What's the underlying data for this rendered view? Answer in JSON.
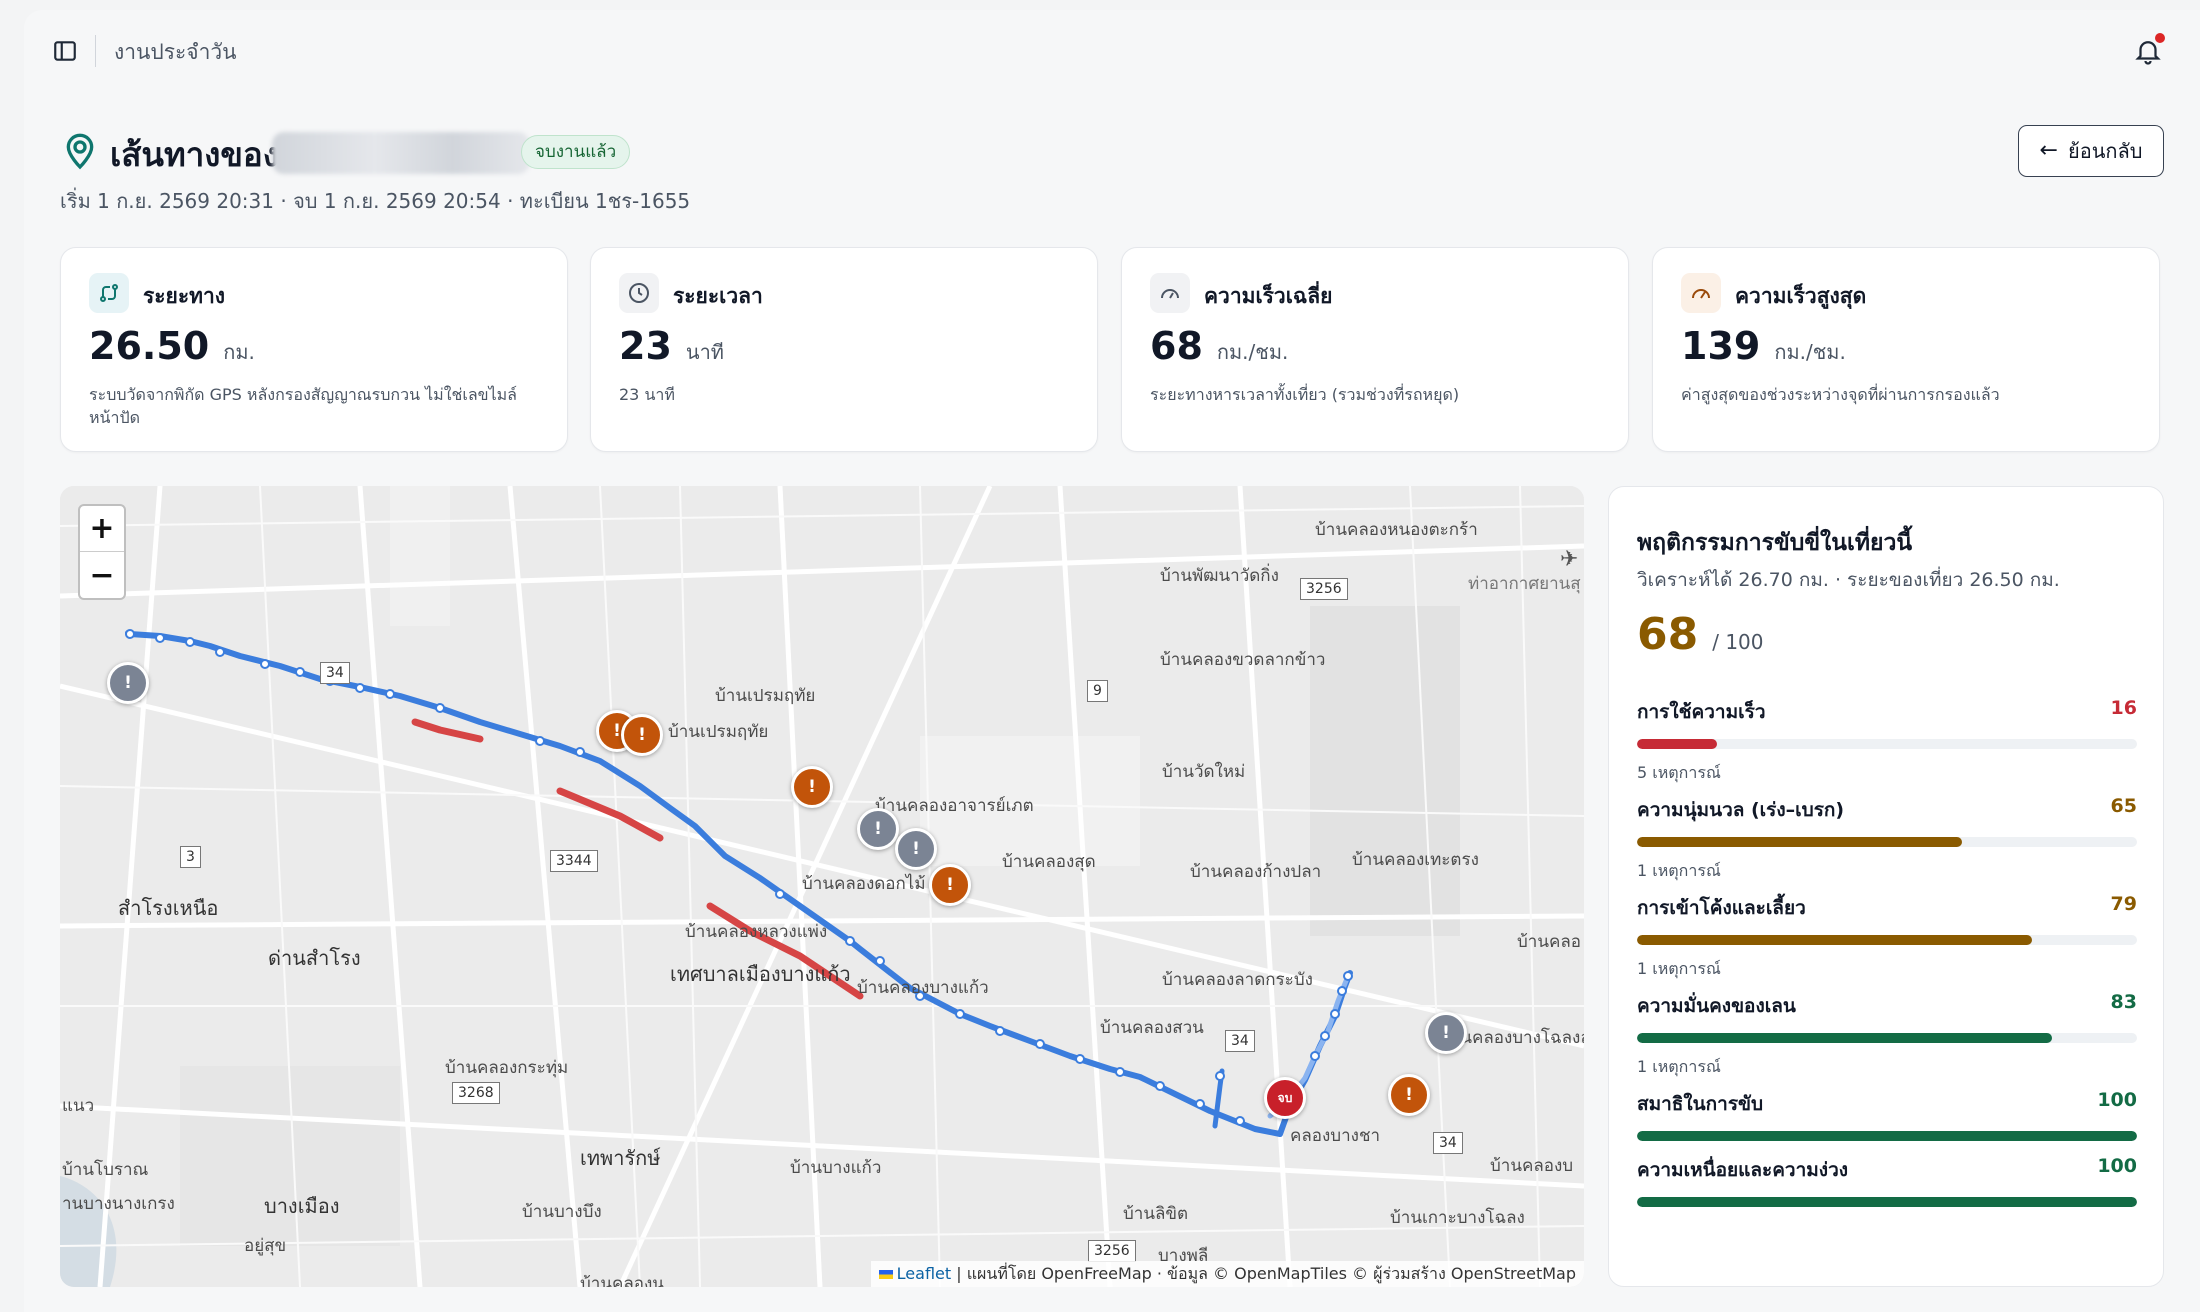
{
  "topbar": {
    "breadcrumb": "งานประจำวัน"
  },
  "header": {
    "title": "เส้นทางของ",
    "status": "จบงานแล้ว",
    "subtitle": "เริ่ม 1 ก.ย. 2569 20:31 · จบ 1 ก.ย. 2569 20:54 · ทะเบียน 1ชร-1655",
    "back_label": "ย้อนกลับ"
  },
  "stats": [
    {
      "title": "ระยะทาง",
      "value": "26.50",
      "unit": "กม.",
      "note": "ระบบวัดจากพิกัด GPS หลังกรองสัญญาณรบกวน ไม่ใช่เลขไมล์หน้าปัด"
    },
    {
      "title": "ระยะเวลา",
      "value": "23",
      "unit": "นาที",
      "note": "23 นาที"
    },
    {
      "title": "ความเร็วเฉลี่ย",
      "value": "68",
      "unit": "กม./ชม.",
      "note": "ระยะทางหารเวลาทั้งเที่ยว (รวมช่วงที่รถหยุด)"
    },
    {
      "title": "ความเร็วสูงสุด",
      "value": "139",
      "unit": "กม./ชม.",
      "note": "ค่าสูงสุดของช่วงระหว่างจุดที่ผ่านการกรองแล้ว"
    }
  ],
  "map": {
    "zoom_in": "+",
    "zoom_out": "−",
    "labels": [
      "บ้านคลองหนองตะกร้า",
      "บ้านพัฒนาวัดกิ่ง",
      "ท่าอากาศยานสุ",
      "บ้านคลองขวดลากข้าว",
      "บ้านเปรมฤทัย",
      "บ้านเปรมฤทัย",
      "บ้านวัดใหม่",
      "บ้านคลองอาจารย์เภต",
      "บ้านคลองสุด",
      "บ้านคลองก้างปลา",
      "บ้านคลองเทะตรง",
      "บ้านคลองดอกไม้",
      "บ้านคลองหลวงแพ่ง",
      "เทศบาลเมืองบางแก้ว",
      "บ้านคลองบางแก้ว",
      "บ้านคลองลาดกระบัง",
      "บ้านคลองสวน",
      "บ้านคลองบางโฉลงล่",
      "บ้านคลอ",
      "สำโรงเหนือ",
      "ด่านสำโรง",
      "บ้านคลองกระทุ่ม",
      "เทพารักษ์",
      "บ้านบางแก้ว",
      "คลองบางชา",
      "บ้านคลองบ",
      "บ้านโบราณ",
      "านบางนางเกรง",
      "บางเมือง",
      "อยู่สุข",
      "บ้านบางบึง",
      "บ้านลิขิต",
      "บ้านเกาะบางโฉลง",
      "บางพลี",
      "แนว",
      "บ้านคลองน"
    ],
    "shields": [
      "34",
      "3256",
      "9",
      "3",
      "3344",
      "3268",
      "34",
      "34",
      "3256"
    ],
    "markers": [
      {
        "type": "info",
        "symbol": "!"
      },
      {
        "type": "warn",
        "symbol": "!"
      },
      {
        "type": "warn",
        "symbol": "!"
      },
      {
        "type": "warn",
        "symbol": "!"
      },
      {
        "type": "info",
        "symbol": "!"
      },
      {
        "type": "info",
        "symbol": "!"
      },
      {
        "type": "warn",
        "symbol": "!"
      },
      {
        "type": "info",
        "symbol": "!"
      },
      {
        "type": "warn",
        "symbol": "!"
      },
      {
        "type": "end",
        "symbol": "จบ"
      }
    ],
    "attribution_leaflet": "Leaflet",
    "attribution_rest": "| แผนที่โดย OpenFreeMap · ข้อมูล © OpenMapTiles © ผู้ร่วมสร้าง OpenStreetMap",
    "route_colors": {
      "normal": "#3b7ddd",
      "speeding": "#d64545"
    }
  },
  "behavior": {
    "title": "พฤติกรรมการขับขี่ในเที่ยวนี้",
    "subtitle": "วิเคราะห์ได้ 26.70 กม. · ระยะของเที่ยว 26.50 กม.",
    "score": "68",
    "score_max": "/ 100",
    "metrics": [
      {
        "label": "การใช้ความเร็ว",
        "value": 16,
        "count": "5 เหตุการณ์",
        "color": "#c62b36"
      },
      {
        "label": "ความนุ่มนวล (เร่ง–เบรก)",
        "value": 65,
        "count": "1 เหตุการณ์",
        "color": "#8a5a00"
      },
      {
        "label": "การเข้าโค้งและเลี้ยว",
        "value": 79,
        "count": "1 เหตุการณ์",
        "color": "#8a5a00"
      },
      {
        "label": "ความมั่นคงของเลน",
        "value": 83,
        "count": "1 เหตุการณ์",
        "color": "#136b45"
      },
      {
        "label": "สมาธิในการขับ",
        "value": 100,
        "count": "",
        "color": "#136b45"
      },
      {
        "label": "ความเหนื่อยและความง่วง",
        "value": 100,
        "count": "",
        "color": "#136b45"
      }
    ]
  }
}
